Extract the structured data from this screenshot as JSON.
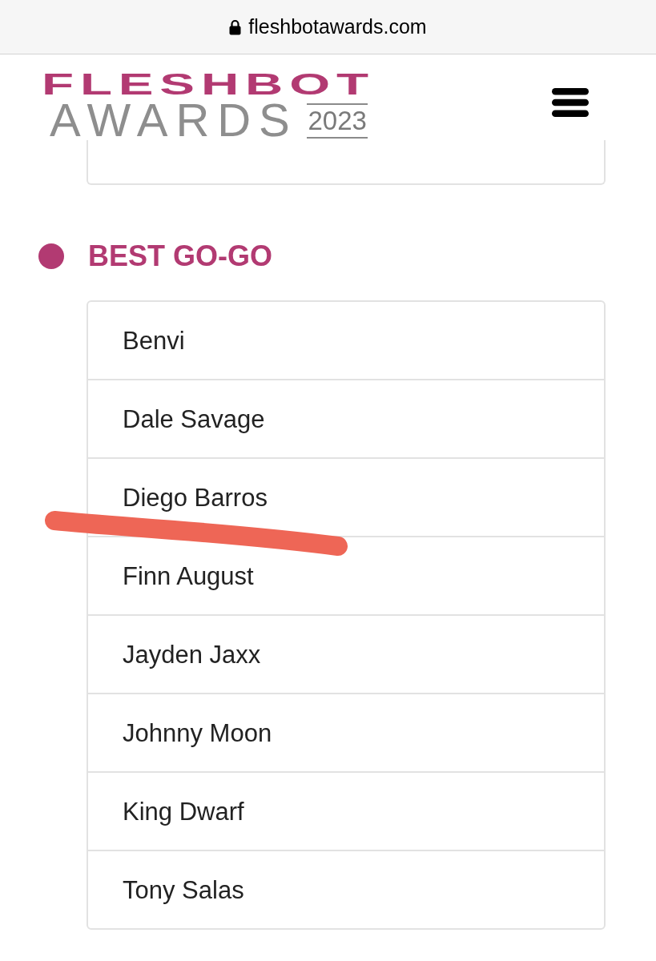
{
  "browser_bar": {
    "url": "fleshbotawards.com"
  },
  "header": {
    "logo": {
      "brand": "FLESHBOT",
      "subtitle": "AWARDS",
      "year": "2023"
    }
  },
  "category": {
    "title": "BEST GO-GO",
    "nominees": [
      {
        "name": "Benvi"
      },
      {
        "name": "Dale Savage"
      },
      {
        "name": "Diego Barros"
      },
      {
        "name": "Finn August"
      },
      {
        "name": "Jayden Jaxx"
      },
      {
        "name": "Johnny Moon"
      },
      {
        "name": "King Dwarf"
      },
      {
        "name": "Tony Salas"
      }
    ]
  }
}
